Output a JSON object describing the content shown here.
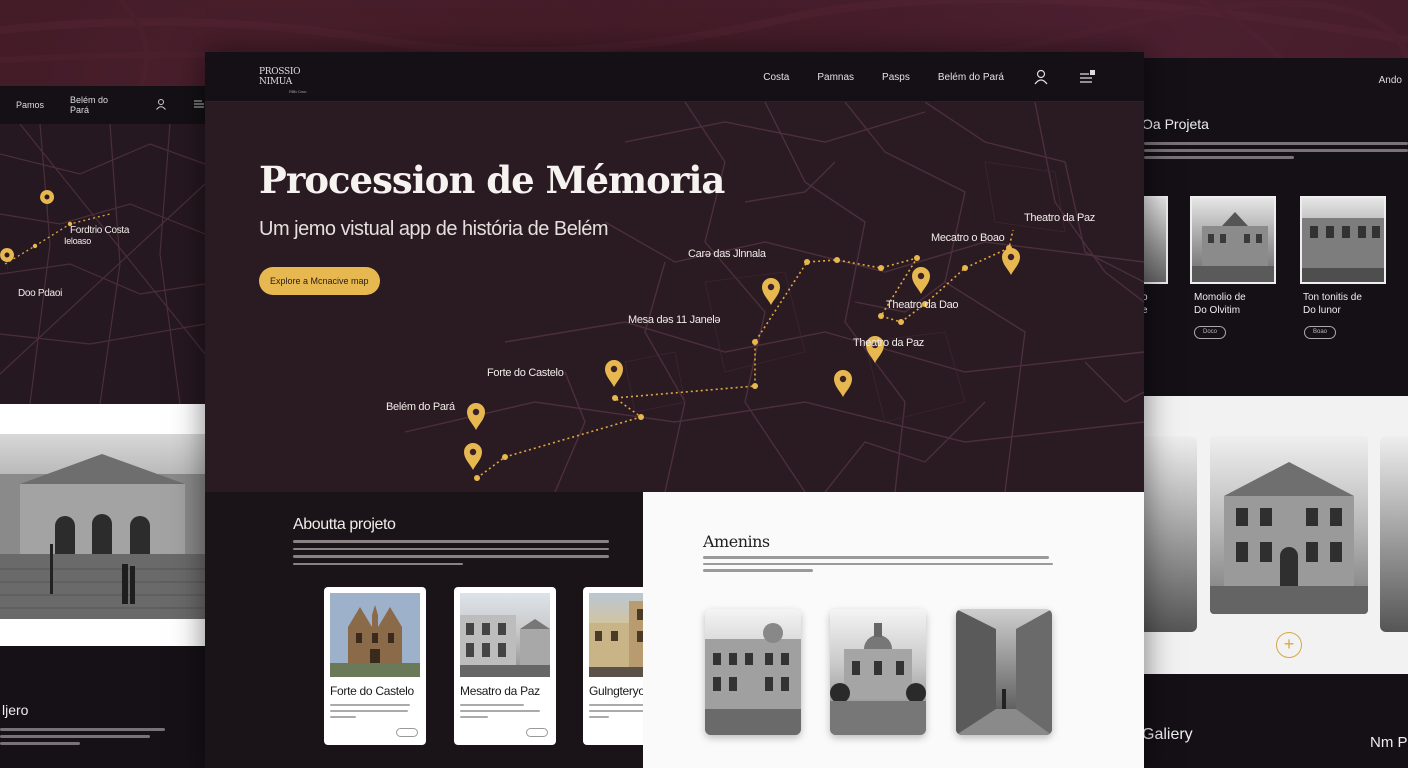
{
  "main": {
    "logo": {
      "line1": "PROSSIO",
      "line2": "NIMUA",
      "tagline": "Pilfo Crue"
    },
    "nav": [
      "Costa",
      "Pamnas",
      "Pasps",
      "Belém do Pará"
    ],
    "hero": {
      "title": "Procession de Mémoria",
      "subtitle": "Um jemo vistual app de história de Belém",
      "cta": "Explore a Mcnacive map"
    },
    "map_labels": {
      "belem": "Belém do Pará",
      "forte": "Forte do Castelo",
      "mesa": "Mesa dəs 11 Janelə",
      "casa": "Carə das Jlnnala",
      "mercado": "Mecatro o Boao",
      "theatro_top": "Theatro da Paz",
      "theatro_mid": "Theatro da Dao",
      "theatro_low": "Theatro da Paz"
    },
    "about": {
      "title": "Aboutta projeto",
      "cards": [
        {
          "title": "Forte do Castelo"
        },
        {
          "title": "Mesatro da Paz"
        },
        {
          "title": "Gulngteryo"
        }
      ]
    },
    "amenities": {
      "title": "Amenins"
    }
  },
  "left": {
    "nav": [
      "Pamos",
      "Belém do Pará"
    ],
    "map_labels": [
      "Fordtrio Costa",
      "Ieloaso",
      "Doo Pdaoi"
    ],
    "footer_title": "ljero"
  },
  "right": {
    "nav": "Ando",
    "title": "Oa Projeta",
    "cards": [
      {
        "label1": "Momolio de",
        "label2": "Do Olvitim",
        "pill": "Doco"
      },
      {
        "label1": "Ton tonitis de",
        "label2": "Do lunor",
        "pill": "Boao"
      }
    ],
    "gallery": "Galiery",
    "nm": "Nm P"
  },
  "colors": {
    "accent": "#e8b850",
    "route": "#e2a83c",
    "bg_maroon": "#3b1823",
    "panel_dark": "#1a1419"
  }
}
